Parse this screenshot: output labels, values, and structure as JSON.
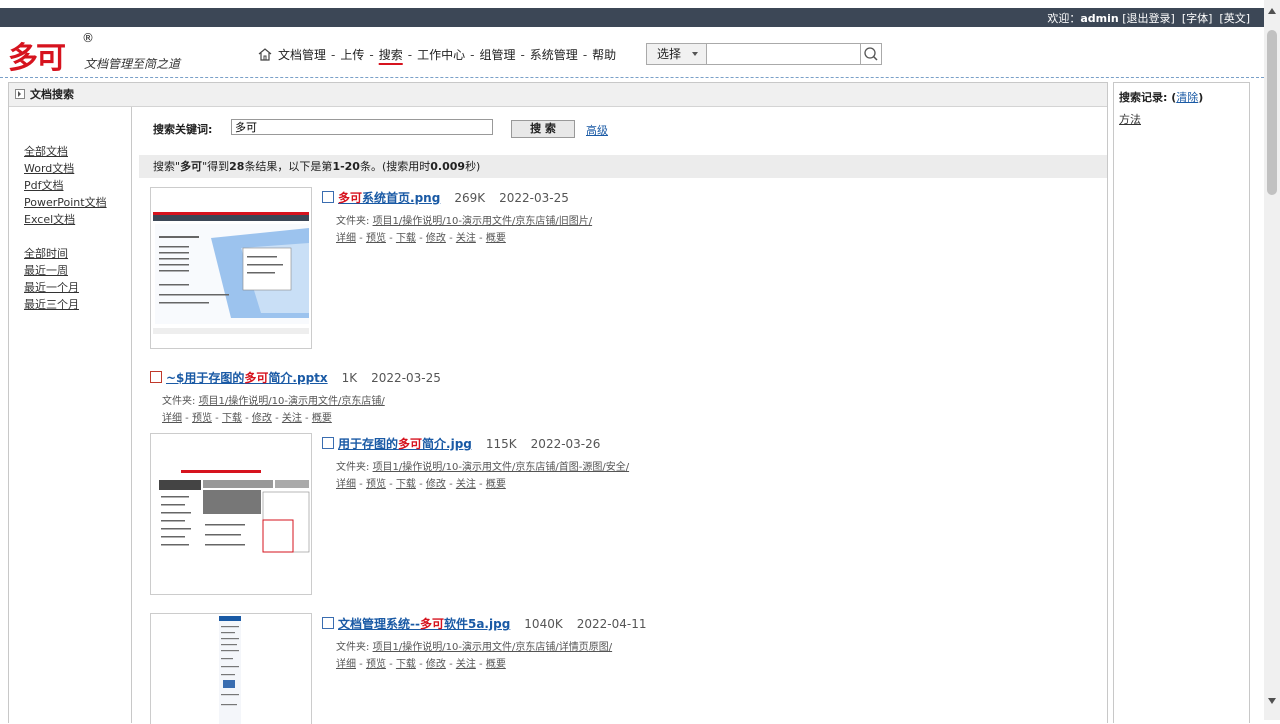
{
  "topbar": {
    "welcome": "欢迎：",
    "user": "admin",
    "logout": "[退出登录]",
    "font": "[字体]",
    "english": "[英文]"
  },
  "logo": {
    "main": "多可",
    "reg": "®",
    "sub": "文档管理至简之道"
  },
  "nav": {
    "items": [
      "文档管理",
      "上传",
      "搜索",
      "工作中心",
      "组管理",
      "系统管理",
      "帮助"
    ]
  },
  "topsearch": {
    "select": "选择",
    "placeholder": ""
  },
  "panel": {
    "title": "文档搜索"
  },
  "filters": {
    "types": [
      "全部文档",
      "Word文档",
      "Pdf文档",
      "PowerPoint文档",
      "Excel文档"
    ],
    "times": [
      "全部时间",
      "最近一周",
      "最近一个月",
      "最近三个月"
    ]
  },
  "search": {
    "label": "搜索关键词:",
    "value": "多可",
    "button": "搜 索",
    "advanced": "高级"
  },
  "summary": {
    "p1": "搜索\"",
    "kw": "多可",
    "p2": "\"得到",
    "count": "28",
    "p3": "条结果，以下是第",
    "range": "1-20",
    "p4": "条。(搜索用时",
    "time": "0.009",
    "p5": "秒)"
  },
  "folder_label": "文件夹:",
  "actions": [
    "详细",
    "预览",
    "下载",
    "修改",
    "关注",
    "概要"
  ],
  "results": [
    {
      "pre": "",
      "hl": "多可",
      "post": "系统首页.png",
      "size": "269K",
      "date": "2022-03-25",
      "folder": "项目1/操作说明/10-演示用文件/京东店铺/旧图片/"
    },
    {
      "pre": "~$用于存图的",
      "hl": "多可",
      "post": "简介.pptx",
      "size": "1K",
      "date": "2022-03-25",
      "folder": "项目1/操作说明/10-演示用文件/京东店铺/"
    },
    {
      "pre": "用于存图的",
      "hl": "多可",
      "post": "简介.jpg",
      "size": "115K",
      "date": "2022-03-26",
      "folder": "项目1/操作说明/10-演示用文件/京东店铺/首图-源图/安全/"
    },
    {
      "pre": "文档管理系统--",
      "hl": "多可",
      "post": "软件5a.jpg",
      "size": "1040K",
      "date": "2022-04-11",
      "folder": "项目1/操作说明/10-演示用文件/京东店铺/详情页原图/"
    }
  ],
  "history": {
    "label": "搜索记录:",
    "clear": "清除",
    "items": [
      "方法"
    ]
  },
  "colors": {
    "topbar": "#3c4756",
    "brand": "#d6131e",
    "link": "#1a5aa5"
  }
}
